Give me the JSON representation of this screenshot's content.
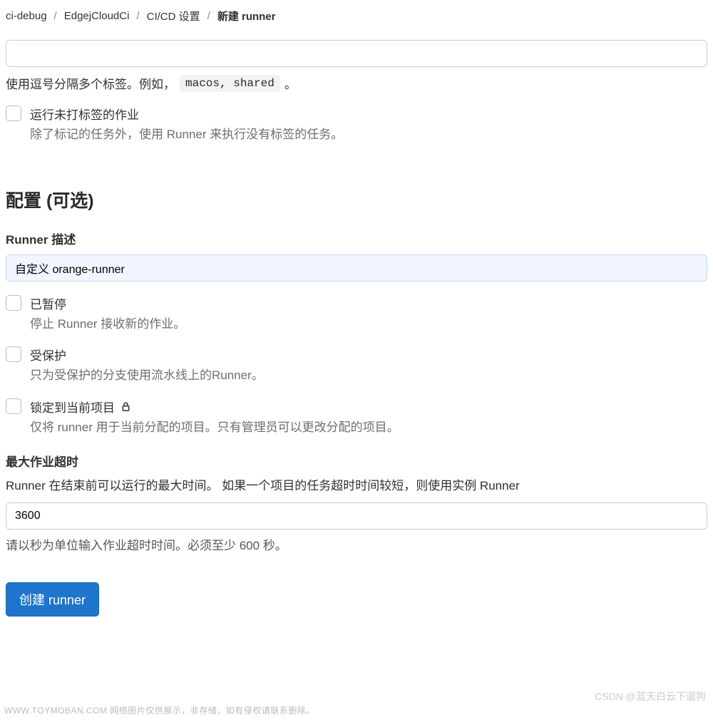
{
  "breadcrumb": {
    "items": [
      "ci-debug",
      "EdgejCloudCi",
      "CI/CD 设置",
      "新建 runner"
    ],
    "separator": "/"
  },
  "tags": {
    "help_prefix": "使用逗号分隔多个标签。例如，",
    "help_code": "macos, shared",
    "help_suffix": "。"
  },
  "run_untagged": {
    "label": "运行未打标签的作业",
    "help": "除了标记的任务外，使用 Runner 来执行没有标签的任务。"
  },
  "config_heading": "配置 (可选)",
  "description": {
    "label": "Runner 描述",
    "value": "自定义 orange-runner"
  },
  "paused": {
    "label": "已暂停",
    "help": "停止 Runner 接收新的作业。"
  },
  "protected": {
    "label": "受保护",
    "help": "只为受保护的分支使用流水线上的Runner。"
  },
  "locked": {
    "label": "锁定到当前项目",
    "help": "仅将 runner 用于当前分配的项目。只有管理员可以更改分配的项目。"
  },
  "timeout": {
    "label": "最大作业超时",
    "help_above": "Runner 在结束前可以运行的最大时间。 如果一个项目的任务超时时间较短，则使用实例 Runner",
    "value": "3600",
    "help_below": "请以秒为单位输入作业超时时间。必须至少 600 秒。"
  },
  "submit": {
    "label": "创建 runner"
  },
  "watermarks": {
    "left": "WWW.TOYMOBAN.COM 网络图片仅供展示，非存储，如有侵权请联系删除。",
    "right": "CSDN @蓝天白云下遛狗"
  }
}
